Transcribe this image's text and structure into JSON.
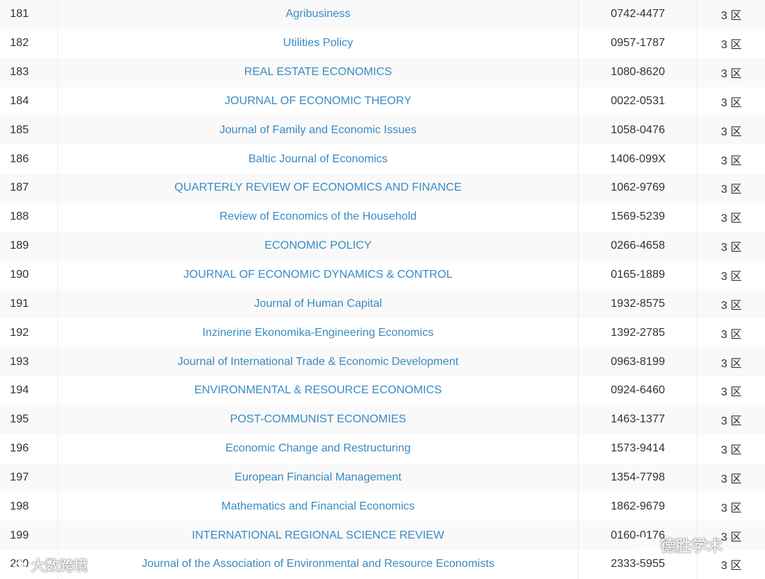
{
  "journals": [
    {
      "rank": "181",
      "name": "Agribusiness",
      "issn": "0742-4477",
      "zone": "3 区"
    },
    {
      "rank": "182",
      "name": "Utilities Policy",
      "issn": "0957-1787",
      "zone": "3 区"
    },
    {
      "rank": "183",
      "name": "REAL ESTATE ECONOMICS",
      "issn": "1080-8620",
      "zone": "3 区"
    },
    {
      "rank": "184",
      "name": "JOURNAL OF ECONOMIC THEORY",
      "issn": "0022-0531",
      "zone": "3 区"
    },
    {
      "rank": "185",
      "name": "Journal of Family and Economic Issues",
      "issn": "1058-0476",
      "zone": "3 区"
    },
    {
      "rank": "186",
      "name": "Baltic Journal of Economics",
      "issn": "1406-099X",
      "zone": "3 区"
    },
    {
      "rank": "187",
      "name": "QUARTERLY REVIEW OF ECONOMICS AND FINANCE",
      "issn": "1062-9769",
      "zone": "3 区"
    },
    {
      "rank": "188",
      "name": "Review of Economics of the Household",
      "issn": "1569-5239",
      "zone": "3 区"
    },
    {
      "rank": "189",
      "name": "ECONOMIC POLICY",
      "issn": "0266-4658",
      "zone": "3 区"
    },
    {
      "rank": "190",
      "name": "JOURNAL OF ECONOMIC DYNAMICS & CONTROL",
      "issn": "0165-1889",
      "zone": "3 区"
    },
    {
      "rank": "191",
      "name": "Journal of Human Capital",
      "issn": "1932-8575",
      "zone": "3 区"
    },
    {
      "rank": "192",
      "name": "Inzinerine Ekonomika-Engineering Economics",
      "issn": "1392-2785",
      "zone": "3 区"
    },
    {
      "rank": "193",
      "name": "Journal of International Trade & Economic Development",
      "issn": "0963-8199",
      "zone": "3 区"
    },
    {
      "rank": "194",
      "name": "ENVIRONMENTAL & RESOURCE ECONOMICS",
      "issn": "0924-6460",
      "zone": "3 区"
    },
    {
      "rank": "195",
      "name": "POST-COMMUNIST ECONOMIES",
      "issn": "1463-1377",
      "zone": "3 区"
    },
    {
      "rank": "196",
      "name": "Economic Change and Restructuring",
      "issn": "1573-9414",
      "zone": "3 区"
    },
    {
      "rank": "197",
      "name": "European Financial Management",
      "issn": "1354-7798",
      "zone": "3 区"
    },
    {
      "rank": "198",
      "name": "Mathematics and Financial Economics",
      "issn": "1862-9679",
      "zone": "3 区"
    },
    {
      "rank": "199",
      "name": "INTERNATIONAL REGIONAL SCIENCE REVIEW",
      "issn": "0160-0176",
      "zone": "3 区"
    },
    {
      "rank": "200",
      "name": "Journal of the Association of Environmental and Resource Economists",
      "issn": "2333-5955",
      "zone": "3 区"
    }
  ],
  "watermarks": {
    "left": "大数跨境",
    "right": "德胜学术"
  },
  "icons": {
    "watermark_left": "wechat-icon",
    "watermark_right": "wechat-icon"
  },
  "colors": {
    "link": "#3a8bc4",
    "text": "#333333",
    "stripe": "#f9f9f9"
  }
}
